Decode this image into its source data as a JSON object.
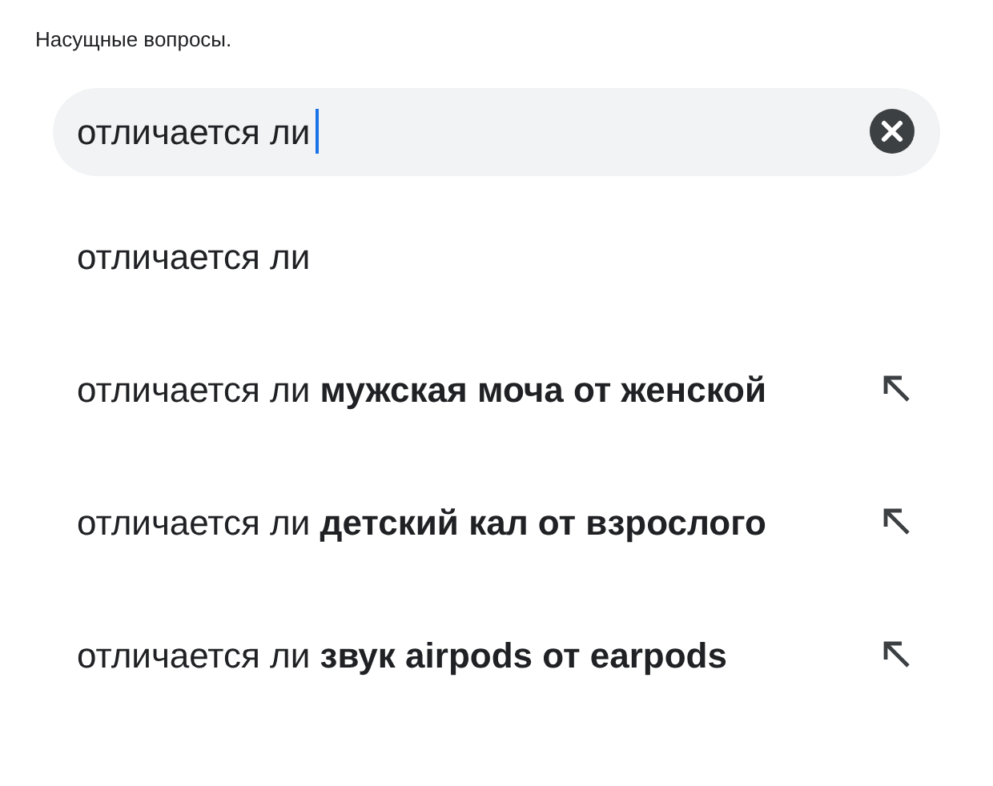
{
  "caption": "Насущные вопросы.",
  "search": {
    "value": "отличается ли",
    "focused": true
  },
  "suggestions": [
    {
      "text": "отличается ли",
      "fill_arrow": false
    },
    {
      "text": "отличается ли **мужская моча от женской**",
      "fill_arrow": true
    },
    {
      "text": "отличается ли **детский кал от взрослого**",
      "fill_arrow": true
    },
    {
      "text": "отличается ли **звук airpods от earpods**",
      "fill_arrow": true
    }
  ]
}
